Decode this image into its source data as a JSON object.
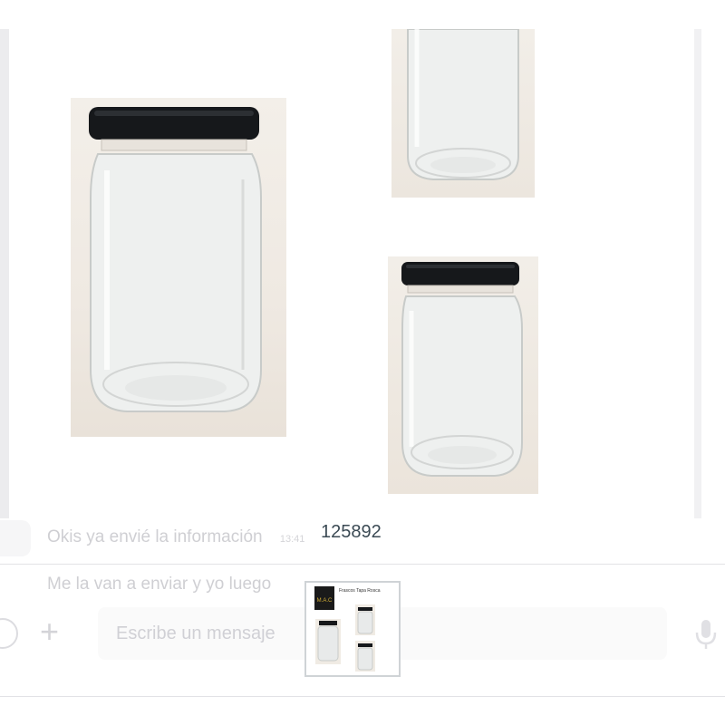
{
  "viewer": {
    "caption": "125892"
  },
  "chat": {
    "messages": [
      {
        "text": "Okis ya envié la información",
        "time": "13:41"
      },
      {
        "text": "Me la van a enviar y yo luego",
        "time": ""
      }
    ]
  },
  "composer": {
    "placeholder": "Escribe un mensaje"
  },
  "thumbnail": {
    "brand": "M.A.C",
    "header": "Frascos Tapa Rosca"
  },
  "icons": {
    "emoji": "emoji-icon",
    "attach": "plus-icon",
    "mic": "microphone-icon"
  },
  "colors": {
    "lid": "#16181b",
    "caption_text": "#3b4a54",
    "thumbnail_border": "#cfd3d6"
  }
}
